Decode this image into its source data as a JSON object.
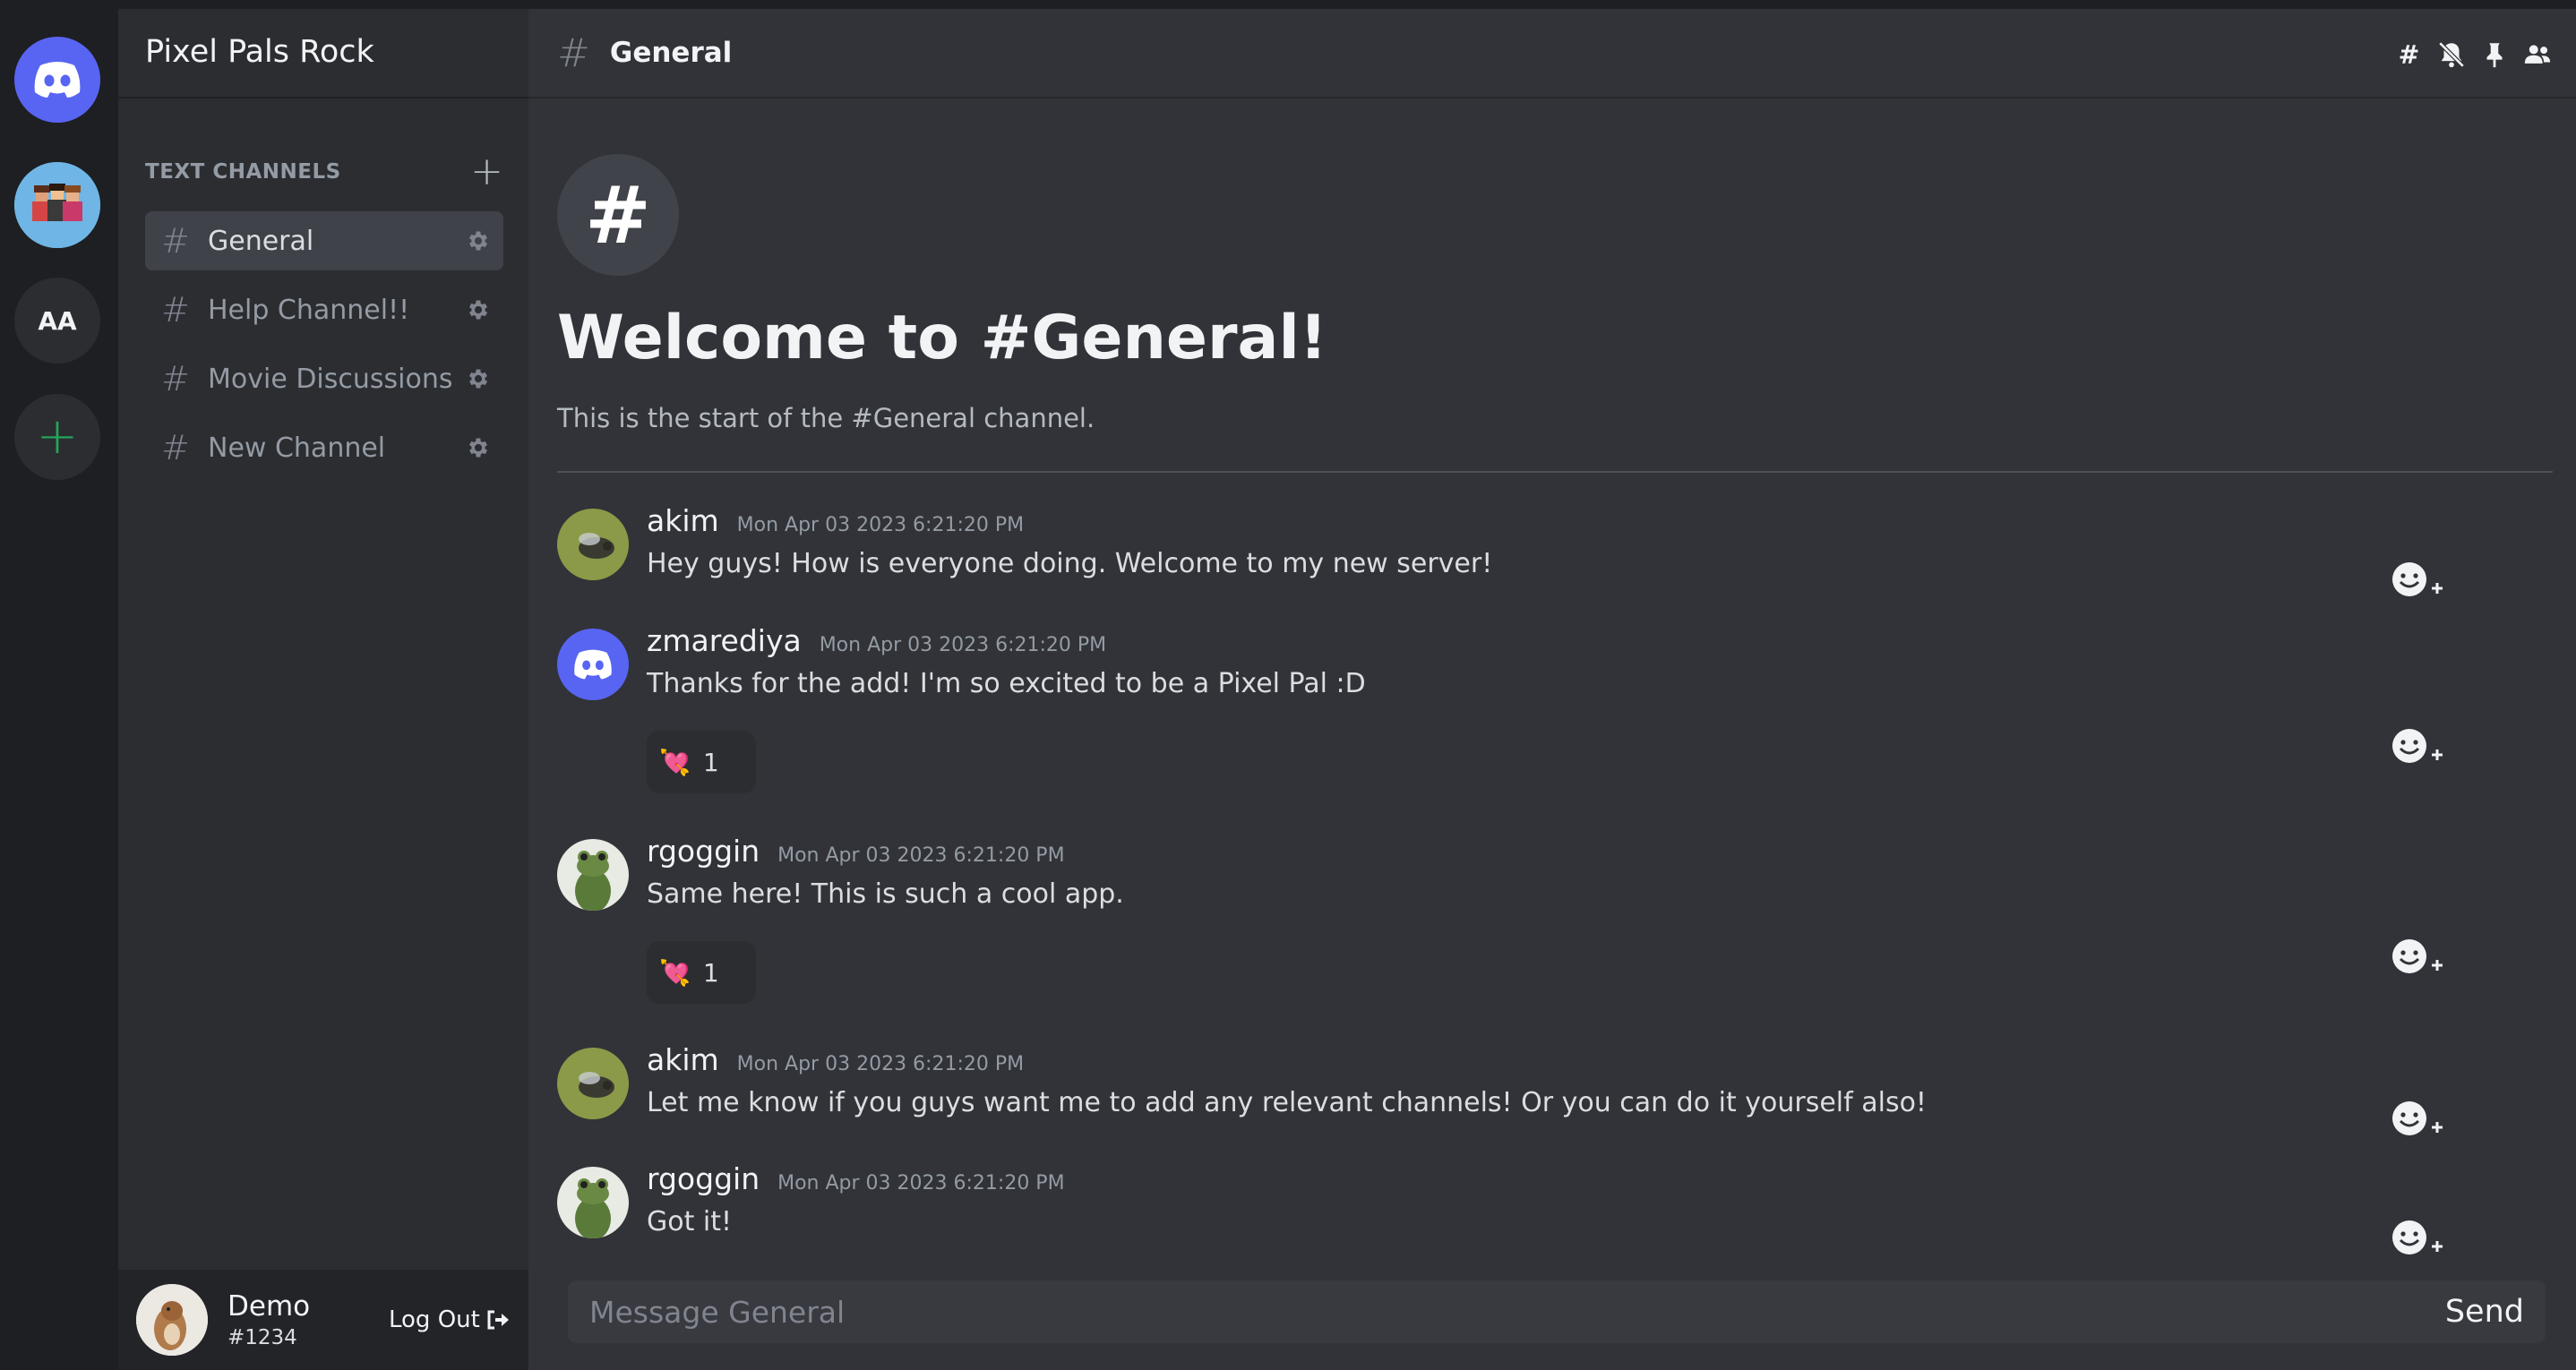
{
  "servers": [
    {
      "name": "discord-home",
      "icon": "discord-logo-icon"
    },
    {
      "name": "Pixel Pals Rock",
      "icon": "pixel-pals-icon"
    },
    {
      "initials": "AA"
    },
    {
      "label": "+"
    }
  ],
  "sidebar": {
    "server_name": "Pixel Pals Rock",
    "category": "TEXT CHANNELS",
    "category_add": "+",
    "channels": [
      {
        "hash": "#",
        "label": "General",
        "active": true
      },
      {
        "hash": "#",
        "label": "Help Channel!!"
      },
      {
        "hash": "#",
        "label": "Movie Discussions"
      },
      {
        "hash": "#",
        "label": "New Channel"
      }
    ]
  },
  "user": {
    "name": "Demo",
    "tag": "#1234",
    "logout_label": "Log Out"
  },
  "header": {
    "hash": "#",
    "title": "General",
    "icons": [
      "threads-icon",
      "mute-bell-icon",
      "pin-icon",
      "members-icon"
    ]
  },
  "welcome": {
    "badge": "#",
    "title": "Welcome to #General!",
    "subtitle": "This is the start of the #General channel."
  },
  "messages": [
    {
      "user": "akim",
      "time": "Mon Apr 03 2023 6:21:20 PM",
      "text": "Hey guys! How is everyone doing. Welcome to my new server!"
    },
    {
      "user": "zmarediya",
      "time": "Mon Apr 03 2023 6:21:20 PM",
      "text": "Thanks for the add! I'm so excited to be a Pixel Pal :D",
      "reaction": {
        "emoji": "💘",
        "count": "1"
      }
    },
    {
      "user": "rgoggin",
      "time": "Mon Apr 03 2023 6:21:20 PM",
      "text": "Same here! This is such a cool app.",
      "reaction": {
        "emoji": "💘",
        "count": "1"
      }
    },
    {
      "user": "akim",
      "time": "Mon Apr 03 2023 6:21:20 PM",
      "text": "Let me know if you guys want me to add any relevant channels! Or you can do it yourself also!"
    },
    {
      "user": "rgoggin",
      "time": "Mon Apr 03 2023 6:21:20 PM",
      "text": "Got it!"
    }
  ],
  "composer": {
    "placeholder": "Message General",
    "send_label": "Send"
  },
  "colors": {
    "blurple": "#5865f2",
    "green": "#23a55a",
    "bg_main": "#313338",
    "bg_sidebar": "#2b2d31",
    "bg_rail": "#1e1f22"
  }
}
